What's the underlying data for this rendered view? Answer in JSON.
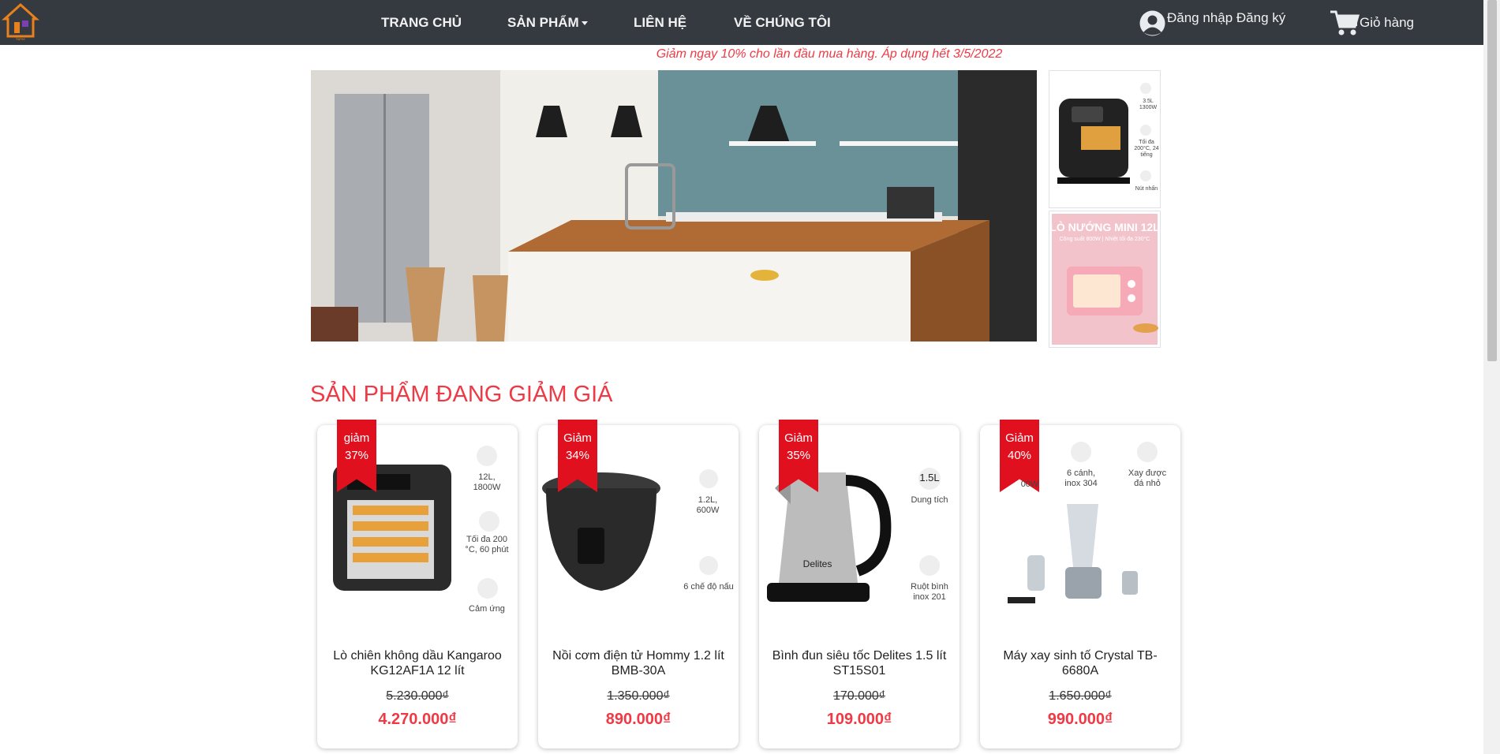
{
  "nav": {
    "home": "TRANG CHỦ",
    "products": "SẢN PHẨM",
    "contact": "LIÊN HỆ",
    "about": "VỀ CHÚNG TÔI",
    "auth": "Đăng nhập Đăng ký",
    "cart": "Giỏ hàng"
  },
  "promo": "Giảm ngay 10% cho lần đầu mua hàng. Áp dụng hết 3/5/2022",
  "side_banner_2": {
    "title": "LÒ NƯỚNG MINI 12L",
    "subtitle": "Công suất 800W | Nhiệt tối đa 230°C"
  },
  "side_banner_1": {
    "f1": "3.5L 1300W",
    "f2": "Tối đa 200°C, 24 tiếng",
    "f3": "Nút nhấn"
  },
  "section_title": "SẢN PHẨM ĐANG GIẢM GIÁ",
  "products": [
    {
      "discount_word": "giảm",
      "discount": "37%",
      "name": "Lò chiên không dầu Kangaroo KG12AF1A 12 lít",
      "old_price": "5.230.000₫",
      "price": "4.270.000₫",
      "f1": "12L, 1800W",
      "f2": "Tối đa 200 °C, 60 phút",
      "f3": "Cảm ứng"
    },
    {
      "discount_word": "Giảm",
      "discount": "34%",
      "name": "Nồi cơm điện tử Hommy 1.2 lít BMB-30A",
      "old_price": "1.350.000₫",
      "price": "890.000₫",
      "f1": "1.2L, 600W",
      "f2": "6 chế độ nấu"
    },
    {
      "discount_word": "Giảm",
      "discount": "35%",
      "name": "Bình đun siêu tốc Delites 1.5 lít ST15S01",
      "old_price": "170.000₫",
      "price": "109.000₫",
      "f1": "1.5L",
      "f1b": "Dung tích",
      "f2": "Ruột bình inox 201",
      "brand": "Delites"
    },
    {
      "discount_word": "Giảm",
      "discount": "40%",
      "name": "Máy xay sinh tố Crystal TB-6680A",
      "old_price": "1.650.000₫",
      "price": "990.000₫",
      "f0": "00W",
      "f1": "6 cánh, inox 304",
      "f2": "Xay được đá nhỏ"
    }
  ]
}
